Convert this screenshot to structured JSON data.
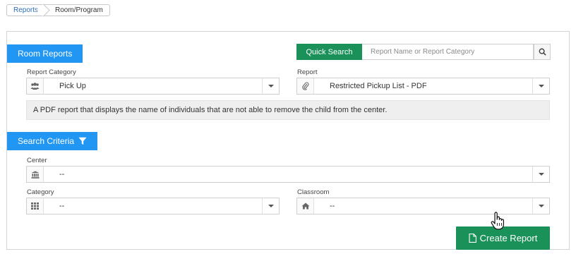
{
  "breadcrumb": {
    "items": [
      "Reports",
      "Room/Program"
    ]
  },
  "room_reports": {
    "title": "Room Reports",
    "quick_search": {
      "button_label": "Quick Search",
      "placeholder": "Report Name or Report Category"
    },
    "report_category": {
      "label": "Report Category",
      "value": "Pick Up",
      "icon": "users-icon"
    },
    "report": {
      "label": "Report",
      "value": "Restricted Pickup List - PDF",
      "icon": "paperclip-icon"
    },
    "description": "A PDF report that displays the name of individuals that are not able to remove the child from the center."
  },
  "search_criteria": {
    "title": "Search Criteria",
    "center": {
      "label": "Center",
      "value": "--",
      "icon": "bank-icon"
    },
    "category": {
      "label": "Category",
      "value": "--",
      "icon": "grid-icon"
    },
    "classroom": {
      "label": "Classroom",
      "value": "--",
      "icon": "home-icon"
    }
  },
  "actions": {
    "create_report_label": "Create Report"
  },
  "colors": {
    "primary_blue": "#2196f3",
    "action_green": "#1a9158",
    "link_blue": "#2d6cb5"
  }
}
